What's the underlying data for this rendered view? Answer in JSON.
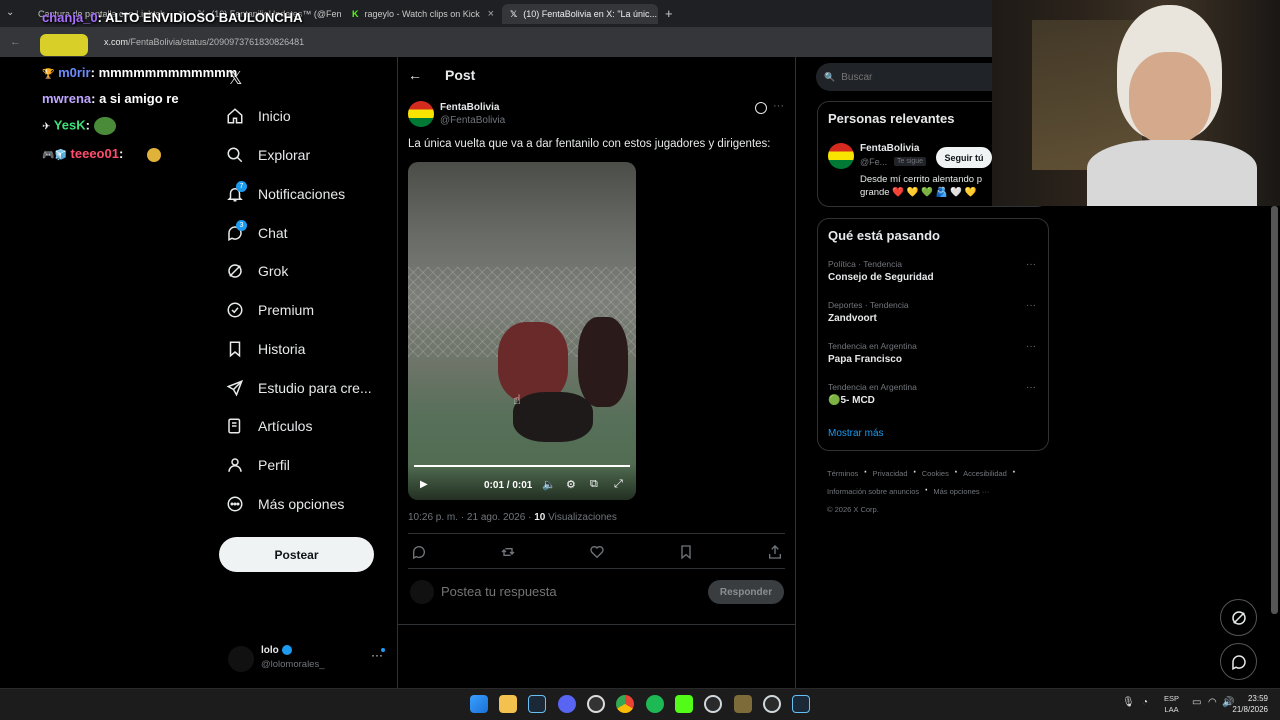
{
  "browser": {
    "tabs": [
      {
        "label": "Captura de pantalla con Lightsh..."
      },
      {
        "label": "(10) FentanilioUpdates™ (@Fen..."
      },
      {
        "label": "rageylo - Watch clips on Kick"
      },
      {
        "label": "(10) FentaBolivia en X: \"La únic..."
      }
    ],
    "url_domain": "x.com",
    "url_path": "/FentaBolivia/status/2090973761830826481"
  },
  "chat": [
    {
      "user": "chanja_0",
      "message": "ALTO ENVIDIOSO BAULONCHA",
      "color": "#a970ff"
    },
    {
      "user": "m0rir",
      "message": "mmmmmmmmmmmm",
      "color": "#6b8cff"
    },
    {
      "user": "mwrena",
      "message": "a si amigo re",
      "color": "#c0a6ff"
    },
    {
      "user": "YesK",
      "message": "",
      "color": "#3ee07a"
    },
    {
      "user": "teeeo01",
      "message": "",
      "color": "#ff4d6d"
    }
  ],
  "nav": {
    "items": [
      {
        "label": "Inicio",
        "icon": "home-icon"
      },
      {
        "label": "Explorar",
        "icon": "search-icon"
      },
      {
        "label": "Notificaciones",
        "icon": "bell-icon",
        "badge": "7"
      },
      {
        "label": "Chat",
        "icon": "chat-icon",
        "badge": "3"
      },
      {
        "label": "Grok",
        "icon": "grok-icon"
      },
      {
        "label": "Premium",
        "icon": "premium-icon"
      },
      {
        "label": "Historia",
        "icon": "bookmark-icon"
      },
      {
        "label": "Estudio para cre...",
        "icon": "rocket-icon"
      },
      {
        "label": "Artículos",
        "icon": "article-icon"
      },
      {
        "label": "Perfil",
        "icon": "person-icon"
      },
      {
        "label": "Más opciones",
        "icon": "more-icon"
      }
    ],
    "post_button": "Postear",
    "account": {
      "name": "lolo",
      "handle": "@lolomorales_"
    }
  },
  "post": {
    "header": "Post",
    "author_name": "FentaBolivia",
    "author_handle": "@FentaBolivia",
    "text": "La única vuelta que va a dar fentanilo con estos jugadores y dirigentes:",
    "video_time": "0:01 / 0:01",
    "video_progress": 1.0,
    "timestamp": "10:26 p. m. · 21 ago. 2026 · ",
    "views_count": "10",
    "views_label": "Visualizaciones",
    "reply_placeholder": "Postea tu respuesta",
    "reply_button": "Responder"
  },
  "sidebar": {
    "search_placeholder": "Buscar",
    "relevant_title": "Personas relevantes",
    "relevant_person": {
      "name": "FentaBolivia",
      "handle": "@Fe...",
      "follows_you": "Te sigue",
      "follow_button": "Seguir tú",
      "bio": "Desde mí cerrito alentando p grande ❤️ 💛 💚 🫂 🤍 💛"
    },
    "trends_title": "Qué está pasando",
    "trends": [
      {
        "category": "Política · Tendencia",
        "name": "Consejo de Seguridad"
      },
      {
        "category": "Deportes · Tendencia",
        "name": "Zandvoort"
      },
      {
        "category": "Tendencia en Argentina",
        "name": "Papa Francisco"
      },
      {
        "category": "Tendencia en Argentina",
        "name": "🟢5- MCD"
      }
    ],
    "show_more": "Mostrar más",
    "footer": [
      "Términos",
      "Privacidad",
      "Cookies",
      "Accesibilidad",
      "Información sobre anuncios",
      "Más opciones ···",
      "© 2026 X Corp."
    ]
  },
  "taskbar": {
    "lang_top": "ESP",
    "lang_bottom": "LAA",
    "time": "23:59",
    "date": "21/8/2026"
  }
}
